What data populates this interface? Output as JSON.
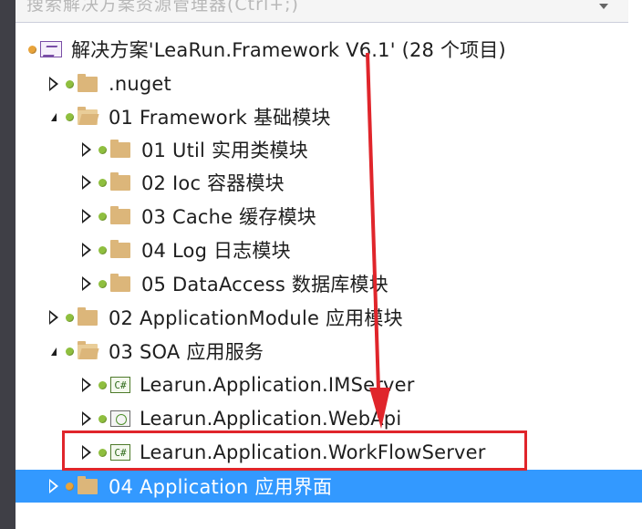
{
  "search": {
    "text": "搜索解决方案资源管理器(Ctrl+;)"
  },
  "tree": {
    "items": [
      {
        "label": "解决方案'LeaRun.Framework V6.1' (28 个项目)",
        "icon": "solution-icon",
        "expander": "none",
        "depth": 0
      },
      {
        "label": ".nuget",
        "icon": "folder-icon",
        "expander": "collapsed",
        "depth": 1
      },
      {
        "label": "01 Framework 基础模块",
        "icon": "folder-open-icon",
        "expander": "expanded",
        "depth": 1
      },
      {
        "label": "01 Util 实用类模块",
        "icon": "folder-icon",
        "expander": "collapsed",
        "depth": 2
      },
      {
        "label": "02 Ioc 容器模块",
        "icon": "folder-icon",
        "expander": "collapsed",
        "depth": 2
      },
      {
        "label": "03 Cache 缓存模块",
        "icon": "folder-icon",
        "expander": "collapsed",
        "depth": 2
      },
      {
        "label": "04 Log 日志模块",
        "icon": "folder-icon",
        "expander": "collapsed",
        "depth": 2
      },
      {
        "label": "05 DataAccess 数据库模块",
        "icon": "folder-icon",
        "expander": "collapsed",
        "depth": 2
      },
      {
        "label": "02 ApplicationModule 应用模块",
        "icon": "folder-icon",
        "expander": "collapsed",
        "depth": 1
      },
      {
        "label": "03 SOA 应用服务",
        "icon": "folder-open-icon",
        "expander": "expanded",
        "depth": 1
      },
      {
        "label": "Learun.Application.IMServer",
        "icon": "csharp-project-icon",
        "expander": "collapsed",
        "depth": 2
      },
      {
        "label": "Learun.Application.WebApi",
        "icon": "web-project-icon",
        "expander": "collapsed",
        "depth": 2
      },
      {
        "label": "Learun.Application.WorkFlowServer",
        "icon": "csharp-project-icon",
        "expander": "collapsed",
        "depth": 2
      },
      {
        "label": "04 Application 应用界面",
        "icon": "folder-icon",
        "expander": "collapsed",
        "depth": 1,
        "selected": true
      }
    ]
  },
  "colors": {
    "selection": "#3399ff",
    "highlight_box": "#e0252b",
    "folder": "#dcb67a"
  },
  "cs_badge": "C#"
}
